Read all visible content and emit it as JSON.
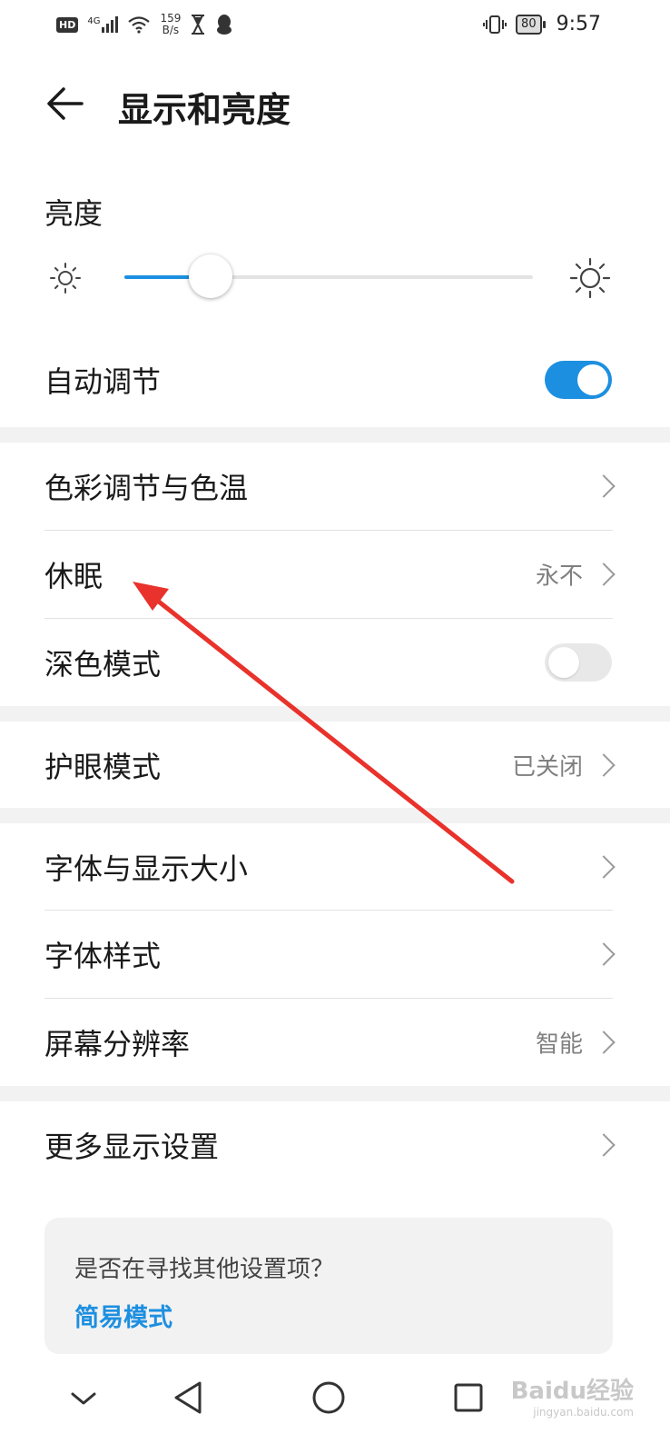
{
  "status_bar": {
    "hd": "HD",
    "net_type": "4G",
    "net_speed_value": "159",
    "net_speed_unit": "B/s",
    "battery": "80",
    "time": "9:57"
  },
  "header": {
    "title": "显示和亮度"
  },
  "brightness": {
    "label": "亮度",
    "level_fraction": 0.21
  },
  "auto_adjust": {
    "label": "自动调节",
    "on": true
  },
  "rows": {
    "color": {
      "label": "色彩调节与色温"
    },
    "sleep": {
      "label": "休眠",
      "value": "永不"
    },
    "dark_mode": {
      "label": "深色模式",
      "on": false
    },
    "eye_comfort": {
      "label": "护眼模式",
      "value": "已关闭"
    },
    "font_size": {
      "label": "字体与显示大小"
    },
    "font_style": {
      "label": "字体样式"
    },
    "resolution": {
      "label": "屏幕分辨率",
      "value": "智能"
    },
    "more_display": {
      "label": "更多显示设置"
    }
  },
  "card": {
    "question": "是否在寻找其他设置项？",
    "link": "简易模式"
  },
  "watermark": {
    "brand": "Baidu经验",
    "site": "jingyan.baidu.com"
  },
  "colors": {
    "accent": "#1d8fe0",
    "annotation_arrow": "#e8322b"
  }
}
